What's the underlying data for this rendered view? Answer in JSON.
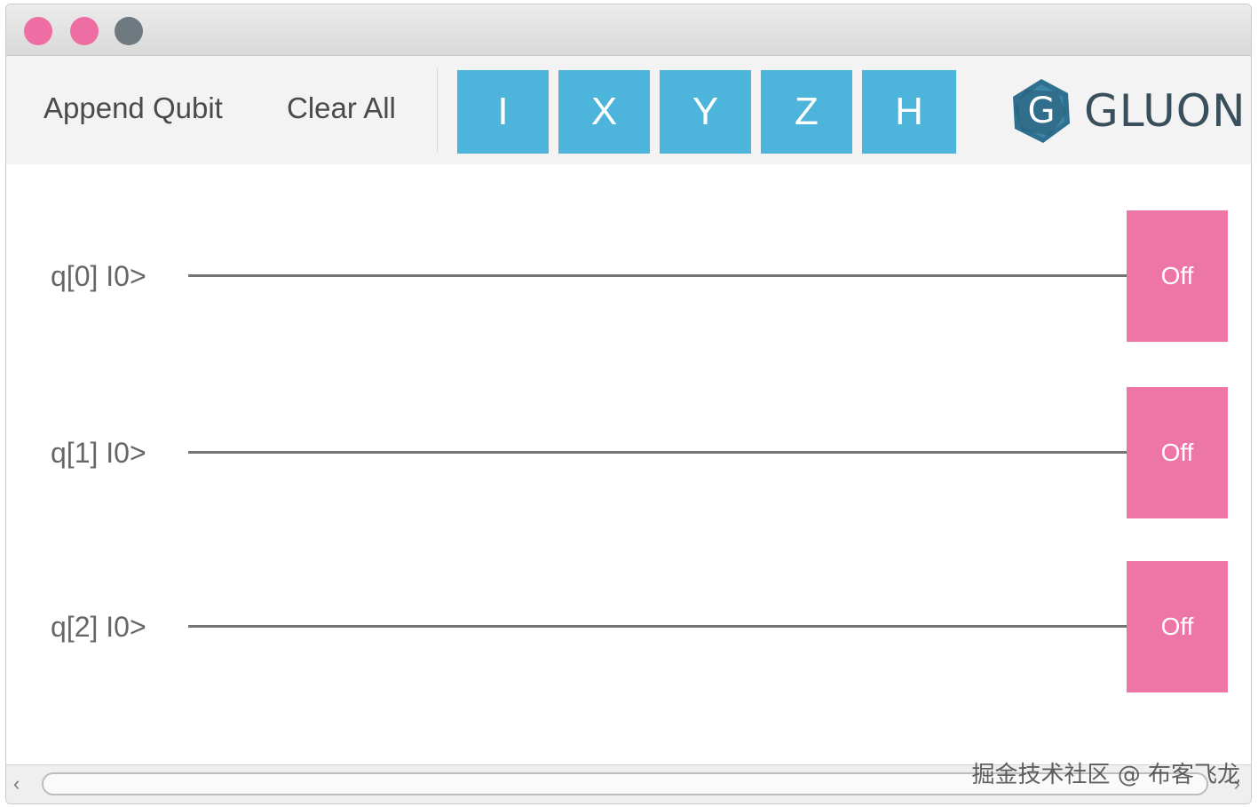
{
  "window": {
    "traffic_lights": {
      "close_color": "#ee6ea3",
      "minimize_color": "#ee6ea3",
      "maximize_color": "#6e7a80"
    }
  },
  "toolbar": {
    "append_qubit_label": "Append Qubit",
    "clear_all_label": "Clear All",
    "gates": [
      "I",
      "X",
      "Y",
      "Z",
      "H"
    ],
    "gate_color": "#4db5dc"
  },
  "logo": {
    "mark_letter": "G",
    "text": "GLUON"
  },
  "qubits": [
    {
      "label": "q[0] I0>",
      "measure_label": "Off"
    },
    {
      "label": "q[1] I0>",
      "measure_label": "Off"
    },
    {
      "label": "q[2] I0>",
      "measure_label": "Off"
    }
  ],
  "measure_color": "#ee76a6",
  "scrollbar": {
    "left_icon": "chevron-left-icon",
    "right_icon": "chevron-right-icon"
  },
  "watermark": "掘金技术社区 @ 布客飞龙"
}
